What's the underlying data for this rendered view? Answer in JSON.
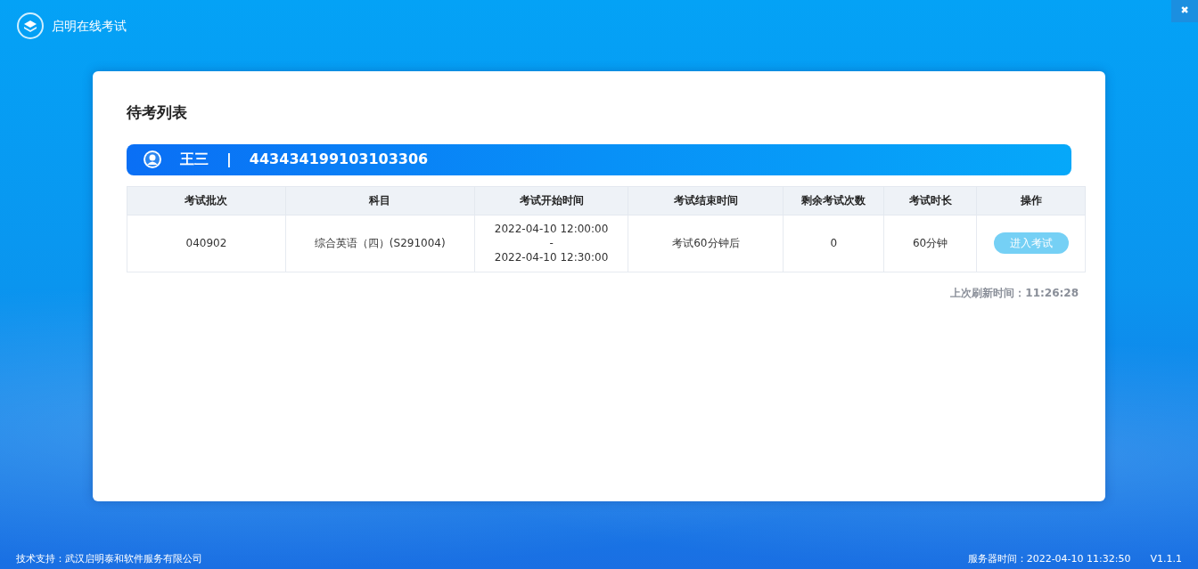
{
  "app": {
    "title": "启明在线考试",
    "close": "✖"
  },
  "card": {
    "title": "待考列表",
    "user": {
      "name": "王三",
      "separator": "|",
      "id": "443434199103103306"
    }
  },
  "table": {
    "columns": [
      "考试批次",
      "科目",
      "考试开始时间",
      "考试结束时间",
      "剩余考试次数",
      "考试时长",
      "操作"
    ],
    "rows": [
      {
        "cells": [
          "040902",
          "综合英语（四）(S291004)",
          [
            "2022-04-10 12:00:00",
            "-",
            "2022-04-10 12:30:00"
          ],
          "考试60分钟后",
          "0",
          "60分钟"
        ],
        "action": {
          "label": "进入考试",
          "disabled": true
        }
      }
    ]
  },
  "refresh": {
    "label": "上次刷新时间：",
    "time": "11:26:28"
  },
  "footer": {
    "support": "技术支持：武汉启明泰和软件服务有限公司",
    "server_time": "服务器时间：2022-04-10 11:32:50",
    "version": "V1.1.1"
  }
}
